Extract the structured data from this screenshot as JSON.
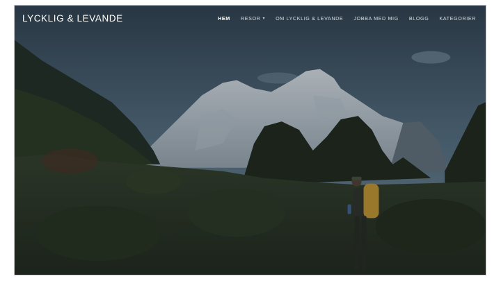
{
  "site": {
    "title": "LYCKLIG & LEVANDE"
  },
  "nav": {
    "items": [
      {
        "label": "HEM",
        "active": true
      },
      {
        "label": "RESOR",
        "dropdown": true
      },
      {
        "label": "OM LYCKLIG & LEVANDE"
      },
      {
        "label": "JOBBA MED MIG"
      },
      {
        "label": "BLOGG"
      },
      {
        "label": "KATEGORIER"
      }
    ],
    "dropdown_icon": "chevron-down-icon"
  },
  "colors": {
    "sky": "#3e5466",
    "overlay": "#22272e",
    "text": "#ffffff"
  }
}
